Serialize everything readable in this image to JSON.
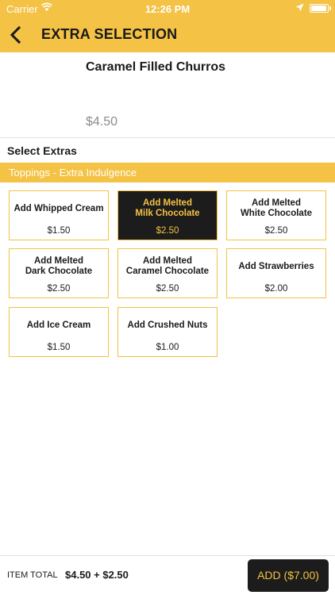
{
  "status_bar": {
    "carrier": "Carrier",
    "time": "12:26 PM"
  },
  "header": {
    "title": "EXTRA SELECTION",
    "back_icon": "chevron-left-icon"
  },
  "product": {
    "name": "Caramel Filled Churros",
    "price": "$4.50"
  },
  "extras": {
    "section_title": "Select Extras",
    "category": "Toppings - Extra Indulgence",
    "options": [
      {
        "label": "Add Whipped Cream",
        "price": "$1.50",
        "selected": false
      },
      {
        "label": "Add Melted\nMilk Chocolate",
        "price": "$2.50",
        "selected": true
      },
      {
        "label": "Add Melted\nWhite Chocolate",
        "price": "$2.50",
        "selected": false
      },
      {
        "label": "Add Melted\nDark Chocolate",
        "price": "$2.50",
        "selected": false
      },
      {
        "label": "Add Melted\nCaramel Chocolate",
        "price": "$2.50",
        "selected": false
      },
      {
        "label": "Add Strawberries",
        "price": "$2.00",
        "selected": false
      },
      {
        "label": "Add Ice Cream",
        "price": "$1.50",
        "selected": false
      },
      {
        "label": "Add Crushed Nuts",
        "price": "$1.00",
        "selected": false
      }
    ]
  },
  "footer": {
    "total_label": "ITEM TOTAL",
    "total_value": "$4.50 + $2.50",
    "add_button": "ADD ($7.00)"
  },
  "colors": {
    "accent": "#f4c244",
    "dark": "#1c1c1c"
  }
}
